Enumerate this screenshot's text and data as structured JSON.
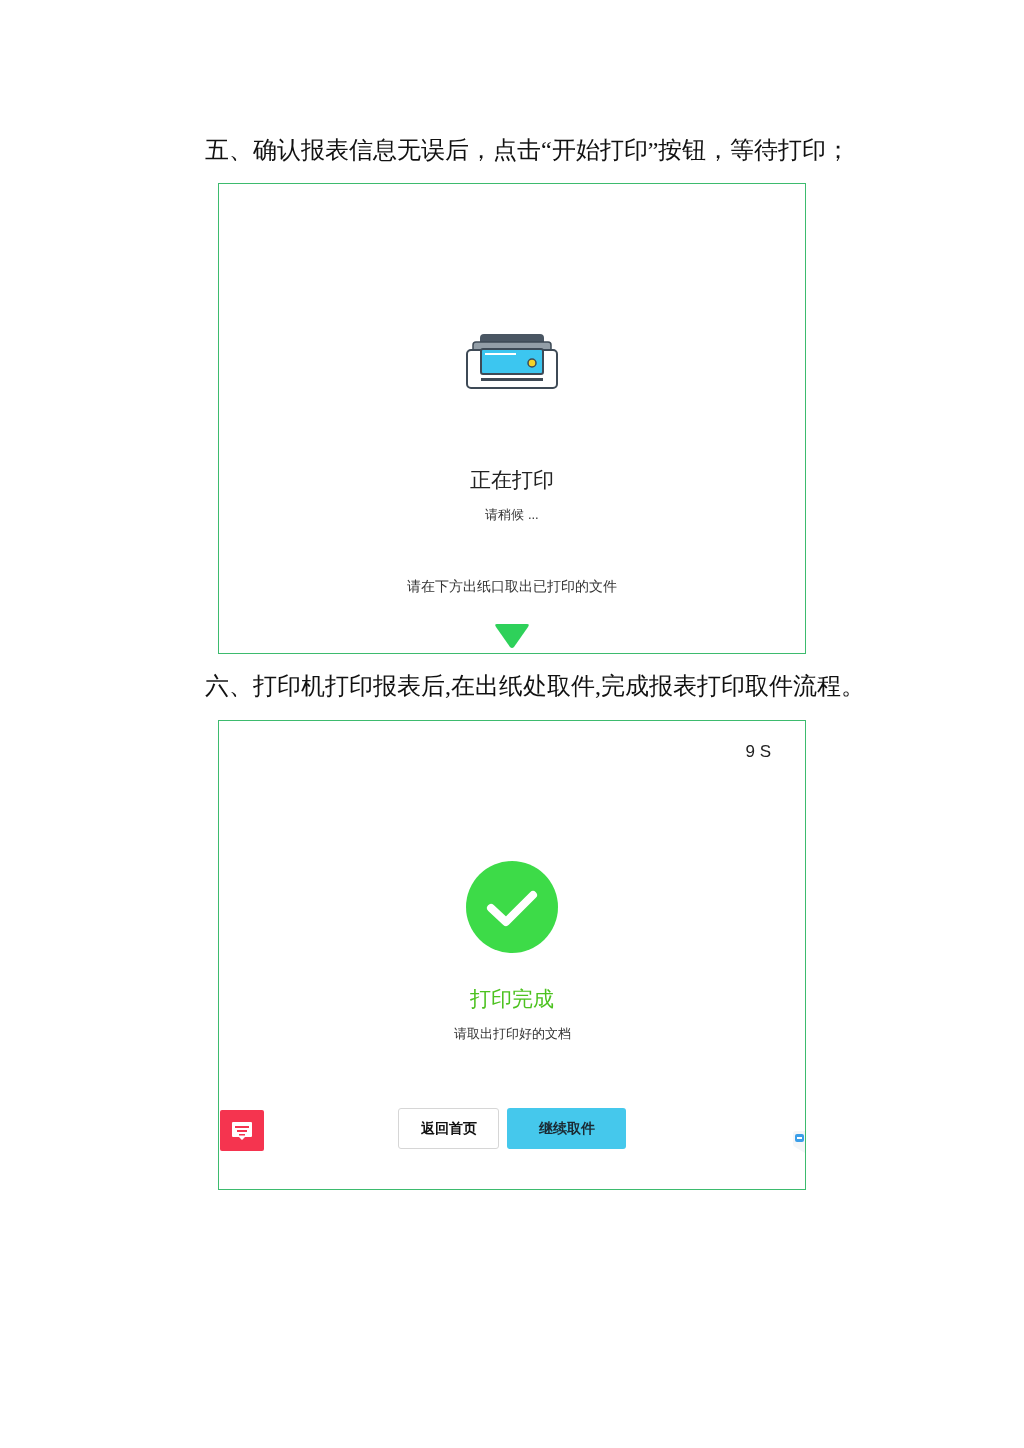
{
  "steps": [
    {
      "heading": "五、确认报表信息无误后，点击“开始打印”按钮，等待打印；",
      "screen": {
        "kind": "printing",
        "title": "正在打印",
        "subtitle": "请稍候 ...",
        "hint": "请在下方出纸口取出已打印的文件"
      }
    },
    {
      "heading": "六、打印机打印报表后,在出纸处取件,完成报表打印取件流程。",
      "screen": {
        "kind": "done",
        "countdown": "9 S",
        "title": "打印完成",
        "subtitle": "请取出打印好的文档",
        "buttons": [
          {
            "label": "返回首页",
            "kind": "secondary"
          },
          {
            "label": "继续取件",
            "kind": "primary"
          }
        ]
      }
    }
  ]
}
